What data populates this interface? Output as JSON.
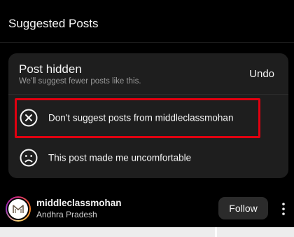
{
  "header": {
    "title": "Suggested Posts"
  },
  "feedback_card": {
    "title": "Post hidden",
    "subtitle": "We'll suggest fewer posts like this.",
    "undo_label": "Undo",
    "options": [
      {
        "label": "Don't suggest posts from middleclassmohan",
        "icon": "x-circle-icon"
      },
      {
        "label": "This post made me uncomfortable",
        "icon": "sad-face-icon"
      }
    ]
  },
  "post": {
    "username": "middleclassmohan",
    "location": "Andhra Pradesh",
    "follow_label": "Follow",
    "avatar_icon": "m-logo-icon"
  },
  "colors": {
    "background": "#000000",
    "card": "#1e1e1e",
    "highlight": "#e00010",
    "follow_button": "#2b2b2b"
  }
}
